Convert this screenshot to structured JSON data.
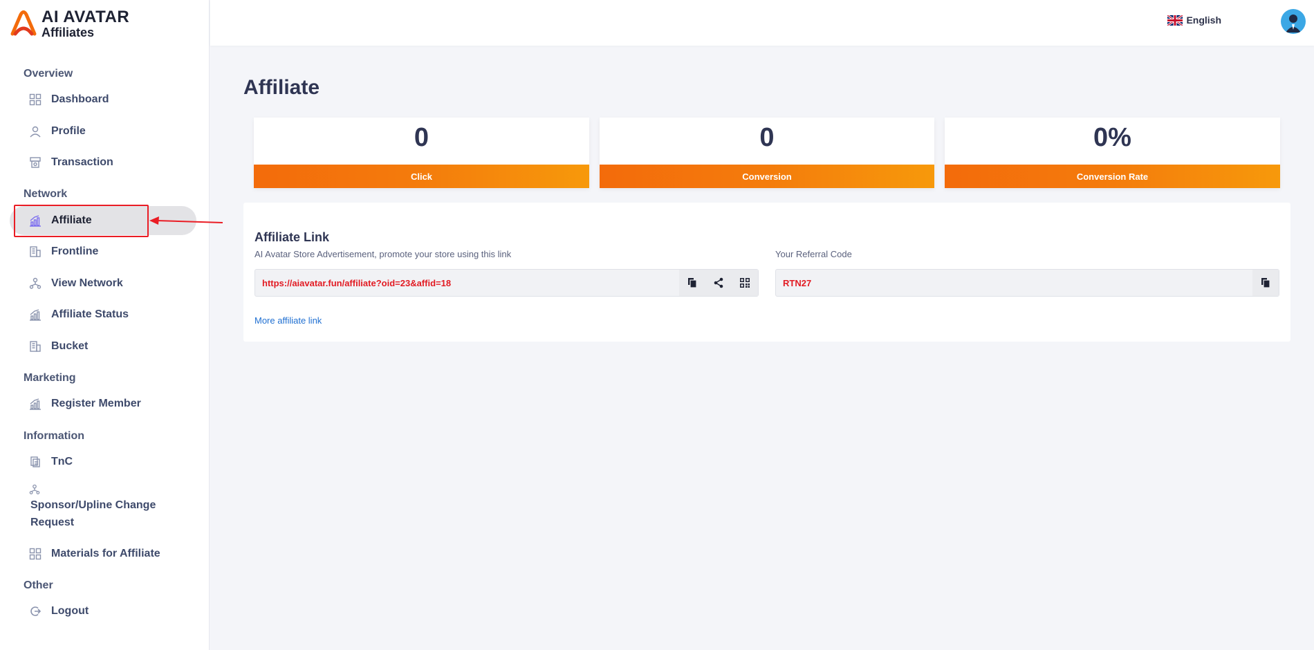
{
  "brand": {
    "line1": "AI AVATAR",
    "line2": "Affiliates"
  },
  "sidebar": {
    "sections": [
      {
        "title": "Overview",
        "items": [
          {
            "label": "Dashboard",
            "icon": "grid-icon"
          },
          {
            "label": "Profile",
            "icon": "user-icon"
          },
          {
            "label": "Transaction",
            "icon": "receipt-icon"
          }
        ]
      },
      {
        "title": "Network",
        "items": [
          {
            "label": "Affiliate",
            "icon": "bar-chart-icon",
            "active": true
          },
          {
            "label": "Frontline",
            "icon": "building-icon"
          },
          {
            "label": "View Network",
            "icon": "network-icon"
          },
          {
            "label": "Affiliate Status",
            "icon": "bar-chart-icon"
          },
          {
            "label": "Bucket",
            "icon": "building-icon"
          }
        ]
      },
      {
        "title": "Marketing",
        "items": [
          {
            "label": "Register Member",
            "icon": "bar-chart-icon"
          }
        ]
      },
      {
        "title": "Information",
        "items": [
          {
            "label": "TnC",
            "icon": "document-icon"
          },
          {
            "label": "Sponsor/Upline Change Request",
            "icon": "network-icon"
          },
          {
            "label": "Materials for Affiliate",
            "icon": "grid-icon"
          }
        ]
      },
      {
        "title": "Other",
        "items": [
          {
            "label": "Logout",
            "icon": "logout-icon"
          }
        ]
      }
    ]
  },
  "topbar": {
    "language": "English"
  },
  "main": {
    "title": "Affiliate",
    "stats": [
      {
        "value": "0",
        "label": "Click"
      },
      {
        "value": "0",
        "label": "Conversion"
      },
      {
        "value": "0%",
        "label": "Conversion Rate"
      }
    ],
    "affiliate_link": {
      "title": "Affiliate Link",
      "subtitle": "AI Avatar Store Advertisement, promote your store using this link",
      "url": "https://aiavatar.fun/affiliate?oid=23&affid=18",
      "referral_label": "Your Referral Code",
      "referral_code": "RTN27",
      "more_link": "More affiliate link"
    }
  },
  "colors": {
    "accent_orange": "#f47c0c",
    "highlight_red": "#ea1c24",
    "link_red": "#e21b23",
    "link_blue": "#1f6fd1"
  }
}
